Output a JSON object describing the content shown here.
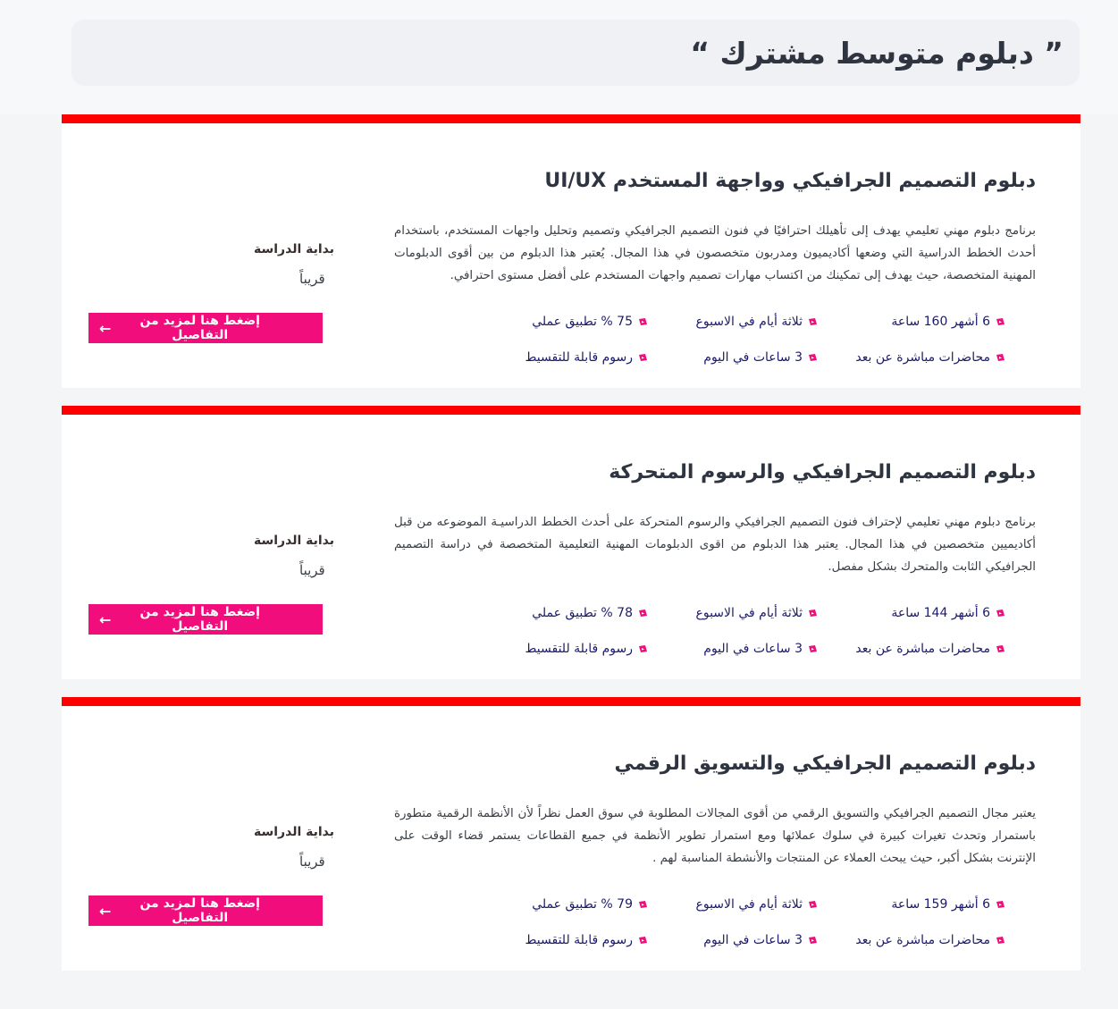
{
  "page_title": "” دبلوم متوسط مشترك “",
  "accent_color": "#f20d7d",
  "border_color": "#ff0000",
  "cards": [
    {
      "title": "دبلوم التصميم الجرافيكي وواجهة المستخدم UI/UX",
      "description": "برنامج دبلوم مهني تعليمي يهدف إلى تأهيلك احترافيًا في فنون التصميم الجرافيكي وتصميم وتحليل واجهات المستخدم، باستخدام أحدث الخطط الدراسية التي وضعها أكاديميون ومدربون متخصصون في هذا المجال. يُعتبر هذا الدبلوم من بين أقوى الدبلومات المهنية المتخصصة، حيث يهدف إلى تمكينك من اكتساب مهارات تصميم واجهات المستخدم على أفضل مستوى احترافي.",
      "facts": [
        "6 أشهر 160 ساعة",
        "ثلاثة أيام في الاسبوع",
        "75 % تطبيق عملي",
        "محاضرات مباشرة عن بعد",
        "3 ساعات في اليوم",
        "رسوم قابلة للتقسيط"
      ],
      "start_label": "بداية الدراسة",
      "start_value": "قريباً",
      "button_label": "إضغط هنا لمزيد من التفاصيل",
      "button_icon": "arrow-left-icon"
    },
    {
      "title": "دبلوم التصميم الجرافيكي والرسوم المتحركة",
      "description": "برنامج دبلوم مهني تعليمي لإحتراف فنون التصميم الجرافيكي والرسوم المتحركة على أحدث الخطط الدراسيـة الموضوعه من قبل أكاديميين متخصصين في هذا المجال. يعتبر هذا الدبلوم من اقوى الدبلومات المهنية التعليمية المتخصصة في دراسة التصميم الجرافيكي الثابت والمتحرك بشكل مفصل.",
      "facts": [
        "6 أشهر 144 ساعة",
        "ثلاثة أيام في الاسبوع",
        "78 % تطبيق عملي",
        "محاضرات مباشرة عن بعد",
        "3 ساعات في اليوم",
        "رسوم قابلة للتقسيط"
      ],
      "start_label": "بداية الدراسة",
      "start_value": "قريباً",
      "button_label": "إضغط هنا لمزيد من التفاصيل",
      "button_icon": "arrow-left-icon"
    },
    {
      "title": "دبلوم التصميم الجرافيكي والتسويق الرقمي",
      "description": "يعتبر مجال التصميم الجرافيكي والتسويق الرقمي من أقوى المجالات المطلوبة في سوق العمل نظراً لأن الأنظمة الرقمية متطورة باستمرار وتحدث تغيرات كبيرة في سلوك عملائها ومع استمرار تطوير الأنظمة في جميع القطاعات يستمر قضاء الوقت على الإنترنت بشكل أكبر، حيث يبحث العملاء عن المنتجات والأنشطة المناسبة لهم .",
      "facts": [
        "6 أشهر 159 ساعة",
        "ثلاثة أيام في الاسبوع",
        "79 % تطبيق عملي",
        "محاضرات مباشرة عن بعد",
        "3 ساعات في اليوم",
        "رسوم قابلة للتقسيط"
      ],
      "start_label": "بداية الدراسة",
      "start_value": "قريباً",
      "button_label": "إضغط هنا لمزيد من التفاصيل",
      "button_icon": "arrow-left-icon"
    }
  ]
}
